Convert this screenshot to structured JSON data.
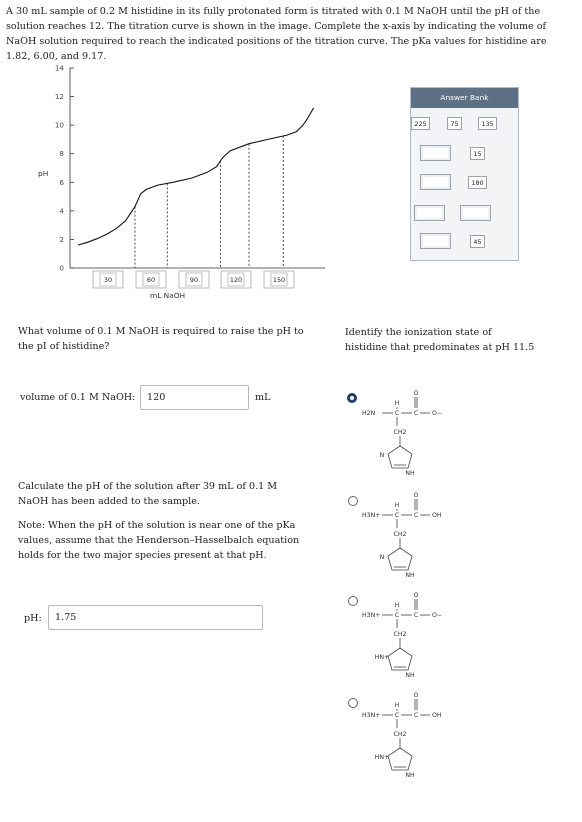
{
  "intro": "A 30 mL sample of 0.2 M histidine in its fully protonated form is titrated with 0.1 M NaOH until the pH of the solution reaches 12. The titration curve is shown in the image. Complete the x-axis by indicating the volume of NaOH solution required to reach the indicated positions of the titration curve. The pKa values for histidine are 1.82, 6.00, and 9.17.",
  "chart_data": {
    "type": "line",
    "ylabel": "pH",
    "xlabel": "mL NaOH",
    "ylim": [
      0,
      14
    ],
    "yticks": [
      0,
      2,
      4,
      6,
      8,
      10,
      12,
      14
    ],
    "slots": [
      "30",
      "60",
      "90",
      "120",
      "150"
    ],
    "curve": [
      [
        0,
        1.6
      ],
      [
        5,
        1.8
      ],
      [
        10,
        2.05
      ],
      [
        15,
        2.35
      ],
      [
        20,
        2.75
      ],
      [
        25,
        3.3
      ],
      [
        30,
        4.3
      ],
      [
        33,
        5.2
      ],
      [
        36,
        5.5
      ],
      [
        42,
        5.8
      ],
      [
        50,
        6.0
      ],
      [
        60,
        6.3
      ],
      [
        68,
        6.7
      ],
      [
        73,
        7.1
      ],
      [
        76,
        7.7
      ],
      [
        80,
        8.2
      ],
      [
        90,
        8.7
      ],
      [
        100,
        9.0
      ],
      [
        110,
        9.3
      ],
      [
        115,
        9.55
      ],
      [
        118,
        9.95
      ],
      [
        120,
        10.3
      ],
      [
        124,
        11.2
      ]
    ],
    "markers_x": [
      30,
      47,
      75,
      90,
      108
    ]
  },
  "answer_bank": {
    "title": "Answer Bank",
    "chips": [
      "225",
      "75",
      "135",
      "15",
      "180",
      "45"
    ]
  },
  "q1": {
    "text": "What volume of 0.1 M NaOH is required to raise the pH to the pI of histidine?",
    "label": "volume of 0.1 M NaOH:",
    "value": "120",
    "unit": "mL"
  },
  "q2": {
    "text": "Calculate the pH of the solution after 39 mL of 0.1 M NaOH has been added to the sample.",
    "note": "Note: When the pH of the solution is near one of the pKa values, assume that the Henderson–Hasselbalch equation holds for the two major species present at that pH.",
    "label": "pH:",
    "value": "1.75"
  },
  "q3": {
    "text": "Identify the ionization state of histidine that predominates at pH 11.5",
    "options": [
      {
        "amine": "H2N",
        "acid": "O−",
        "ring": "N",
        "ring_nh": "NH",
        "selected": true
      },
      {
        "amine": "H3N+",
        "acid": "OH",
        "ring": "N",
        "ring_nh": "NH",
        "selected": false
      },
      {
        "amine": "H3N+",
        "acid": "O−",
        "ring": "HN+",
        "ring_nh": "NH",
        "selected": false
      },
      {
        "amine": "H3N+",
        "acid": "OH",
        "ring": "HN+",
        "ring_nh": "NH",
        "selected": false
      }
    ],
    "struct_labels": {
      "h": "H",
      "c": "C",
      "o": "O",
      "ch2": "CH2"
    }
  }
}
